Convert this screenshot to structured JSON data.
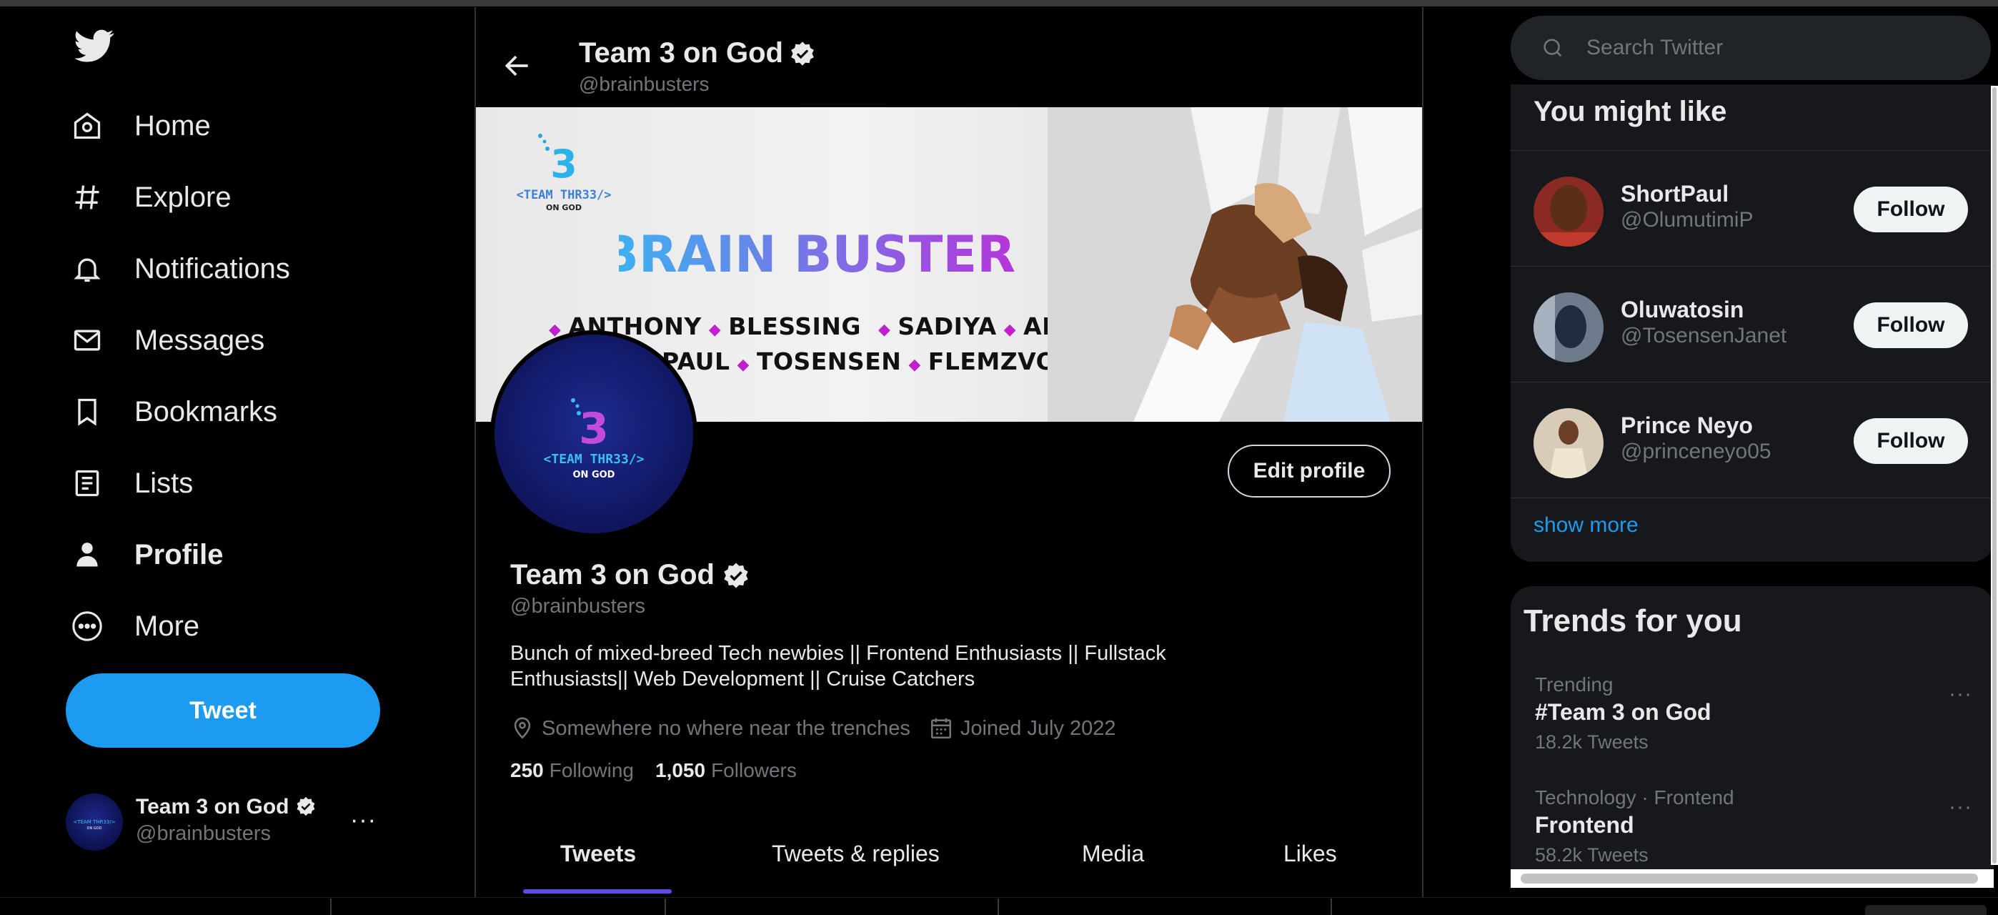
{
  "sidebar": {
    "logo_icon": "twitter-bird-icon",
    "nav": [
      {
        "label": "Home",
        "icon": "home-icon"
      },
      {
        "label": "Explore",
        "icon": "hashtag-icon"
      },
      {
        "label": "Notifications",
        "icon": "bell-icon"
      },
      {
        "label": "Messages",
        "icon": "envelope-icon"
      },
      {
        "label": "Bookmarks",
        "icon": "bookmark-icon"
      },
      {
        "label": "Lists",
        "icon": "list-icon"
      },
      {
        "label": "Profile",
        "icon": "person-icon",
        "active": true
      },
      {
        "label": "More",
        "icon": "more-circle-icon"
      }
    ],
    "tweet_label": "Tweet",
    "account": {
      "name": "Team 3 on God",
      "handle": "@brainbusters",
      "more": "···"
    }
  },
  "header": {
    "title": "Team 3 on God",
    "handle": "@brainbusters"
  },
  "banner": {
    "logo_line1": "<TEAM THR33/>",
    "logo_line2": "ON GOD",
    "title": "BRAIN BUSTERS",
    "row1": [
      "ANTHONY",
      "BLESSING",
      "SADIYA",
      "ADENIYI"
    ],
    "row2": [
      "PAUL",
      "TOSENSEN",
      "FLEMZVON"
    ]
  },
  "profile": {
    "avatar_line1": "<TEAM THR33/>",
    "avatar_line2": "ON GOD",
    "edit_label": "Edit profile",
    "name": "Team 3 on God",
    "handle": "@brainbusters",
    "bio_line1": "Bunch of mixed-breed Tech newbies || Frontend Enthusiasts || Fullstack",
    "bio_line2": "Enthusiasts|| Web Development || Cruise Catchers",
    "location": "Somewhere no where near the trenches",
    "joined": "Joined July 2022",
    "following_count": "250",
    "following_label": "Following",
    "followers_count": "1,050",
    "followers_label": "Followers"
  },
  "tabs": [
    "Tweets",
    "Tweets & replies",
    "Media",
    "Likes"
  ],
  "search": {
    "placeholder": "Search Twitter"
  },
  "you_might_like": {
    "title": "You might like",
    "users": [
      {
        "name": "ShortPaul",
        "handle": "@OlumutimiP",
        "button": "Follow"
      },
      {
        "name": "Oluwatosin",
        "handle": "@TosensenJanet",
        "button": "Follow"
      },
      {
        "name": "Prince Neyo",
        "handle": "@princeneyo05",
        "button": "Follow"
      }
    ],
    "show_more": "show more"
  },
  "trends": {
    "title": "Trends for you",
    "items": [
      {
        "context": "Trending",
        "topic": "#Team 3 on God",
        "count": "18.2k Tweets"
      },
      {
        "context": "Technology · Frontend",
        "topic": "Frontend",
        "count": "58.2k Tweets"
      }
    ],
    "more": "···"
  },
  "colors": {
    "accent": "#1d9bf0",
    "background": "#000000",
    "card": "#16181c",
    "muted": "#71767b",
    "tab_indicator": "#5b4ee8"
  }
}
